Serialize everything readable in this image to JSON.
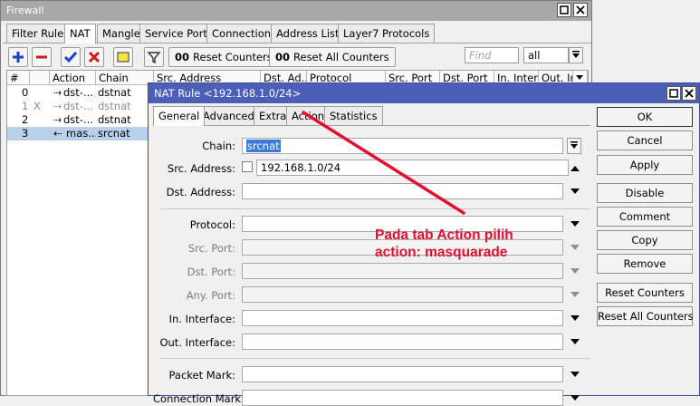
{
  "firewall": {
    "title": "Firewall",
    "tabs": [
      "Filter Rules",
      "NAT",
      "Mangle",
      "Service Ports",
      "Connections",
      "Address Lists",
      "Layer7 Protocols"
    ],
    "active_tab": "NAT",
    "toolbar": {
      "reset_counters": "Reset Counters",
      "reset_all_counters": "Reset All Counters",
      "counter_prefix": "00",
      "find_placeholder": "Find",
      "filter_value": "all"
    },
    "columns": [
      "#",
      "",
      "Action",
      "Chain",
      "Src. Address",
      "Dst. Ad...",
      "Protocol",
      "Src. Port",
      "Dst. Port",
      "In. Inter...",
      "Out. Int..."
    ],
    "rows": [
      {
        "num": "0",
        "flag": "",
        "action": "dst-...",
        "chain": "dstnat"
      },
      {
        "num": "1",
        "flag": "X",
        "action": "dst-...",
        "chain": "dstnat"
      },
      {
        "num": "2",
        "flag": "",
        "action": "dst-...",
        "chain": "dstnat"
      },
      {
        "num": "3",
        "flag": "",
        "action": "mas...",
        "chain": "srcnat"
      }
    ]
  },
  "dialog": {
    "title": "NAT Rule <192.168.1.0/24>",
    "tabs": [
      "General",
      "Advanced",
      "Extra",
      "Action",
      "Statistics"
    ],
    "active_tab": "General",
    "fields": {
      "chain": {
        "label": "Chain:",
        "value": "srcnat"
      },
      "src_address": {
        "label": "Src. Address:",
        "value": "192.168.1.0/24"
      },
      "dst_address": {
        "label": "Dst. Address:",
        "value": ""
      },
      "protocol": {
        "label": "Protocol:",
        "value": ""
      },
      "src_port": {
        "label": "Src. Port:",
        "value": ""
      },
      "dst_port": {
        "label": "Dst. Port:",
        "value": ""
      },
      "any_port": {
        "label": "Any. Port:",
        "value": ""
      },
      "in_interface": {
        "label": "In. Interface:",
        "value": ""
      },
      "out_interface": {
        "label": "Out. Interface:",
        "value": ""
      },
      "packet_mark": {
        "label": "Packet Mark:",
        "value": ""
      },
      "connection_mark": {
        "label": "Connection Mark:",
        "value": ""
      }
    },
    "buttons": {
      "ok": "OK",
      "cancel": "Cancel",
      "apply": "Apply",
      "disable": "Disable",
      "comment": "Comment",
      "copy": "Copy",
      "remove": "Remove",
      "reset_counters": "Reset Counters",
      "reset_all_counters": "Reset All Counters"
    }
  },
  "annotation": {
    "line1": "Pada tab Action pilih",
    "line2": "action: masquarade",
    "color": "#e01030"
  }
}
